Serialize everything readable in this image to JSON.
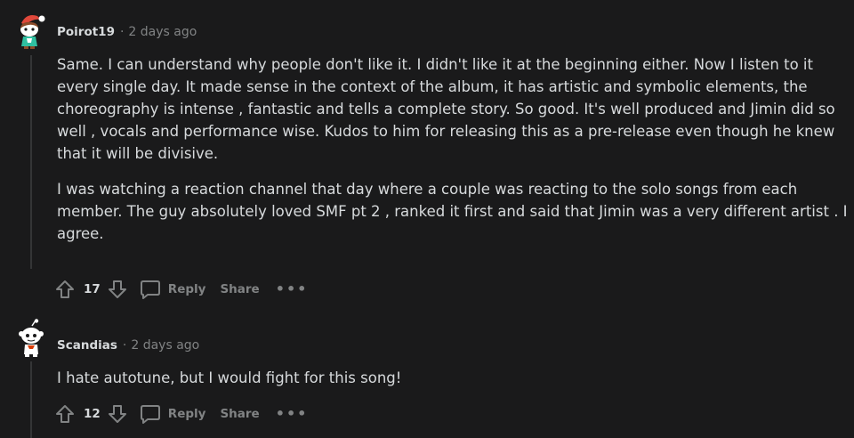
{
  "comments": [
    {
      "author": "Poirot19",
      "separator": "·",
      "time": "2 days ago",
      "paragraphs": [
        "Same. I can understand why people don't like it. I didn't like it at the beginning either. Now I listen to it every single day. It made sense in the context of the album, it has artistic and symbolic elements, the choreography is intense , fantastic and tells a complete story. So good. It's well produced and Jimin did so well , vocals and performance wise. Kudos to him for releasing this as a pre-release even though he knew that it will be divisive.",
        "I was watching a reaction channel that day where a couple was reacting to the solo songs from each member. The guy absolutely loved SMF pt 2 , ranked it first and said that Jimin was a very different artist . I agree."
      ],
      "score": "17",
      "reply_label": "Reply",
      "share_label": "Share",
      "more_label": "•••"
    },
    {
      "author": "Scandias",
      "separator": "·",
      "time": "2 days ago",
      "paragraphs": [
        "I hate autotune, but I would fight for this song!"
      ],
      "score": "12",
      "reply_label": "Reply",
      "share_label": "Share",
      "more_label": "•••"
    }
  ],
  "icons": {
    "upvote": "upvote-icon",
    "downvote": "downvote-icon",
    "reply": "comment-bubble-icon",
    "avatar1": "snoo-avatar-red-hat",
    "avatar2": "snoo-avatar-default"
  },
  "colors": {
    "background": "#1a1a1b",
    "text": "#d7dadc",
    "muted": "#818384",
    "thread_line": "#343536"
  }
}
